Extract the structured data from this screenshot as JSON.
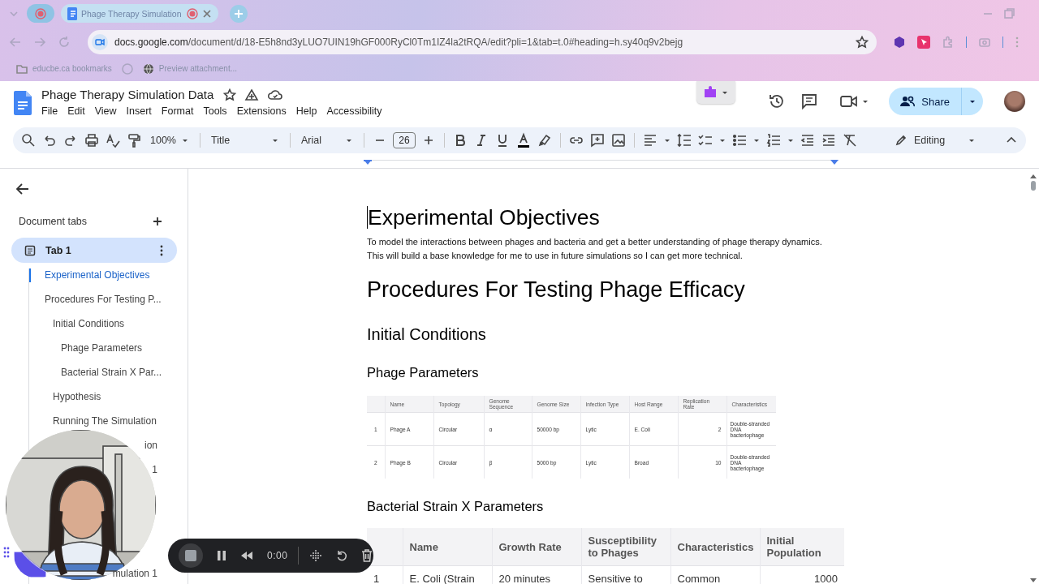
{
  "browser": {
    "tabs": [
      {
        "kind": "pinned",
        "selected": false
      },
      {
        "kind": "page",
        "title": "Phage Therapy Simulation",
        "selected": true
      }
    ],
    "address": {
      "host": "docs.google.com",
      "path": "/document/d/18-E5h8nd3yLUO7UIN19hGF000RyCl0Tm1IZ4la2tRQA/edit?pli=1&tab=t.0#heading=h.sy40q9v2bejg"
    },
    "bookmarks": [
      "educbe.ca bookmarks",
      "Preview attachment..."
    ]
  },
  "docs": {
    "title": "Phage Therapy Simulation Data",
    "menu": [
      "File",
      "Edit",
      "View",
      "Insert",
      "Format",
      "Tools",
      "Extensions",
      "Help",
      "Accessibility"
    ],
    "share": "Share",
    "toolbar": {
      "zoom": "100%",
      "style": "Title",
      "font": "Arial",
      "font_size": "26",
      "mode": "Editing"
    }
  },
  "sidebar": {
    "heading": "Document tabs",
    "tabs": [
      {
        "label": "Tab 1",
        "selected": true
      }
    ],
    "outline": [
      {
        "text": "Experimental Objectives",
        "kind": "full",
        "selected": true
      },
      {
        "text": "Procedures For Testing P...",
        "kind": "full",
        "selected": false,
        "children": [
          {
            "text": "Initial Conditions",
            "kind": "full",
            "selected": false,
            "children": [
              {
                "text": "Phage Parameters",
                "kind": "full",
                "selected": false
              },
              {
                "text": "Bacterial Strain X Par...",
                "kind": "full",
                "selected": false
              }
            ]
          },
          {
            "text": "Hypothesis",
            "kind": "full",
            "selected": false
          },
          {
            "text": "Running The Simulation",
            "kind": "full",
            "selected": false
          },
          {
            "text": "ion",
            "kind": "clipped",
            "selected": false
          },
          {
            "text": "1",
            "kind": "clipped",
            "selected": false
          },
          {
            "text": "mulation 1",
            "kind": "clipped-low",
            "selected": false
          }
        ]
      }
    ]
  },
  "document": {
    "blocks": [
      {
        "kind": "title",
        "text": "Experimental Objectives"
      },
      {
        "kind": "paragraph",
        "text": "To model the interactions between phages and bacteria and get a better understanding of phage therapy dynamics. This will build a base knowledge for me to use in future simulations so I can get more technical."
      },
      {
        "kind": "h1",
        "text": "Procedures For Testing Phage Efficacy"
      },
      {
        "kind": "h2",
        "text": "Initial Conditions"
      },
      {
        "kind": "h3",
        "text": "Phage Parameters"
      },
      {
        "kind": "table-small",
        "columns": [
          {},
          {
            "label": "Name"
          },
          {
            "label": "Topology"
          },
          {
            "label": "Genome Sequence"
          },
          {
            "label": "Genome Size"
          },
          {
            "label": "Infection Type"
          },
          {
            "label": "Host Range"
          },
          {
            "label": "Replication Rate"
          },
          {
            "label": "Characteristics"
          }
        ],
        "rows": [
          [
            "1",
            "Phage A",
            "Circular",
            "α",
            "50000 bp",
            "Lytic",
            "E. Coli",
            "2",
            "Double-stranded DNA bacteriophage"
          ],
          [
            "2",
            "Phage B",
            "Circular",
            "β",
            "5000 bp",
            "Lytic",
            "Broad",
            "10",
            "Double-stranded DNA bacteriophage"
          ]
        ]
      },
      {
        "kind": "h3",
        "text": "Bacterial Strain X Parameters"
      },
      {
        "kind": "table-large",
        "columns": [
          {},
          {
            "label": "Name"
          },
          {
            "label": "Growth Rate"
          },
          {
            "label": "Susceptibility to Phages"
          },
          {
            "label": "Characteristics"
          },
          {
            "label": "Initial Population"
          }
        ],
        "rows": [
          [
            "1",
            "E. Coli (Strain",
            "20 minutes",
            "Sensitive to",
            "Common",
            "1000"
          ]
        ]
      }
    ]
  },
  "recorder": {
    "time": "0:00"
  }
}
